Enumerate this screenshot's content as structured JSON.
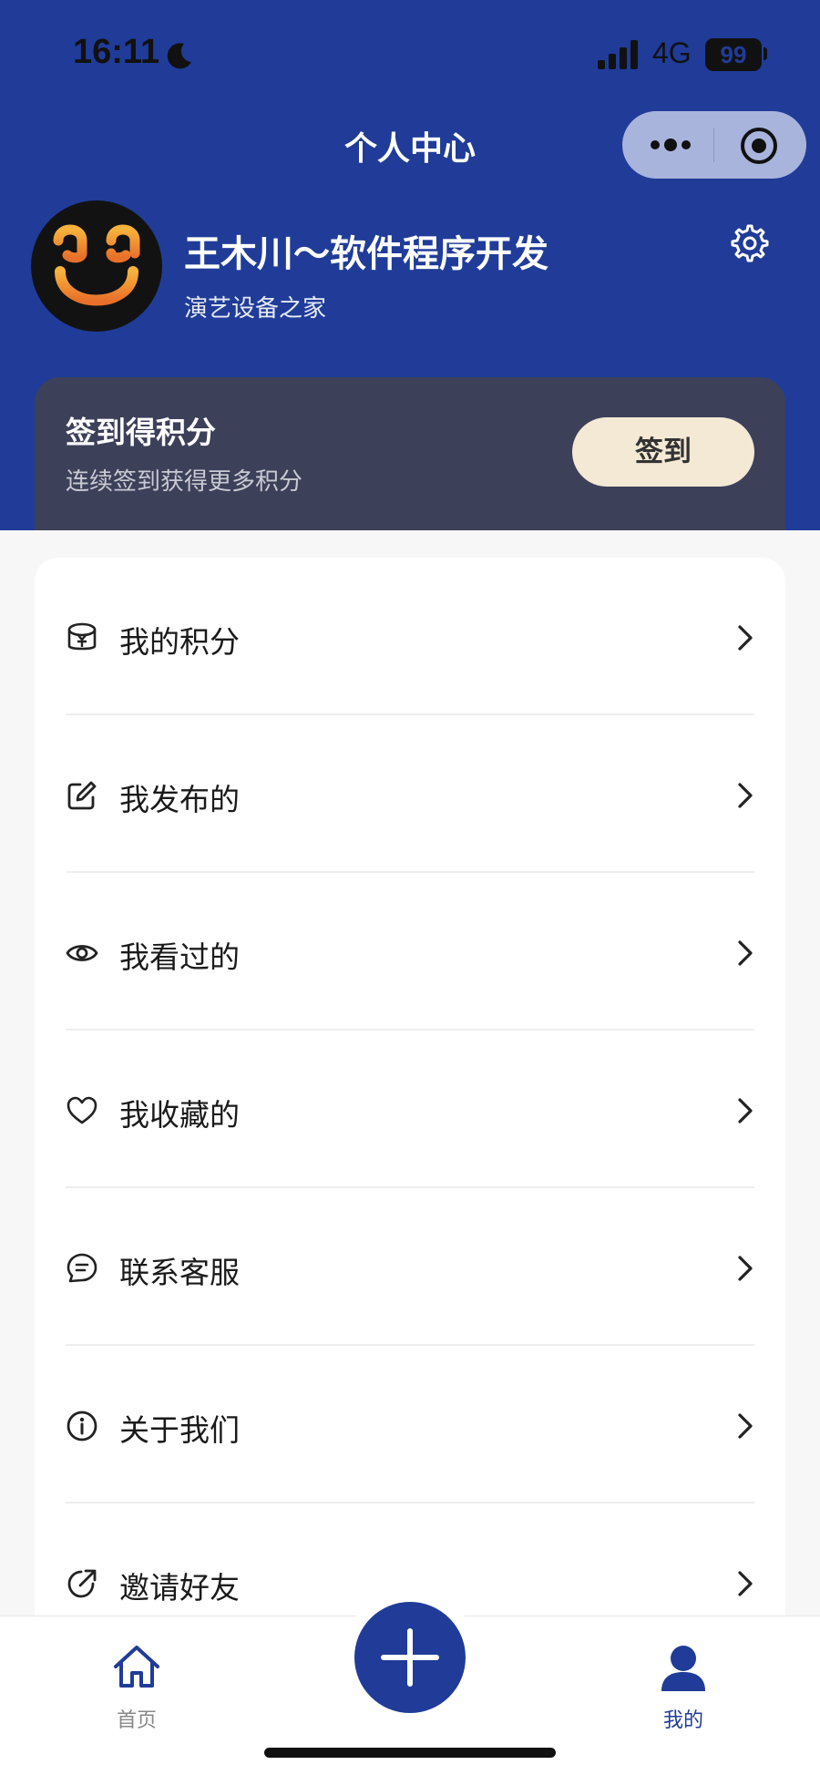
{
  "status_bar": {
    "time": "16:11",
    "network": "4G",
    "battery": "99"
  },
  "nav": {
    "title": "个人中心"
  },
  "profile": {
    "name": "王木川～软件程序开发",
    "org": "演艺设备之家"
  },
  "signin": {
    "title": "签到得积分",
    "subtitle": "连续签到获得更多积分",
    "button": "签到"
  },
  "menu": [
    {
      "label": "我的积分",
      "icon": "points-yen-icon"
    },
    {
      "label": "我发布的",
      "icon": "edit-icon"
    },
    {
      "label": "我看过的",
      "icon": "eye-icon"
    },
    {
      "label": "我收藏的",
      "icon": "heart-icon"
    },
    {
      "label": "联系客服",
      "icon": "chat-icon"
    },
    {
      "label": "关于我们",
      "icon": "info-icon"
    },
    {
      "label": "邀请好友",
      "icon": "share-icon"
    }
  ],
  "tabbar": {
    "home": "首页",
    "mine": "我的"
  },
  "colors": {
    "brand": "#203c98",
    "card_dark": "#3d4059",
    "signin_button": "#f4e9d5"
  }
}
